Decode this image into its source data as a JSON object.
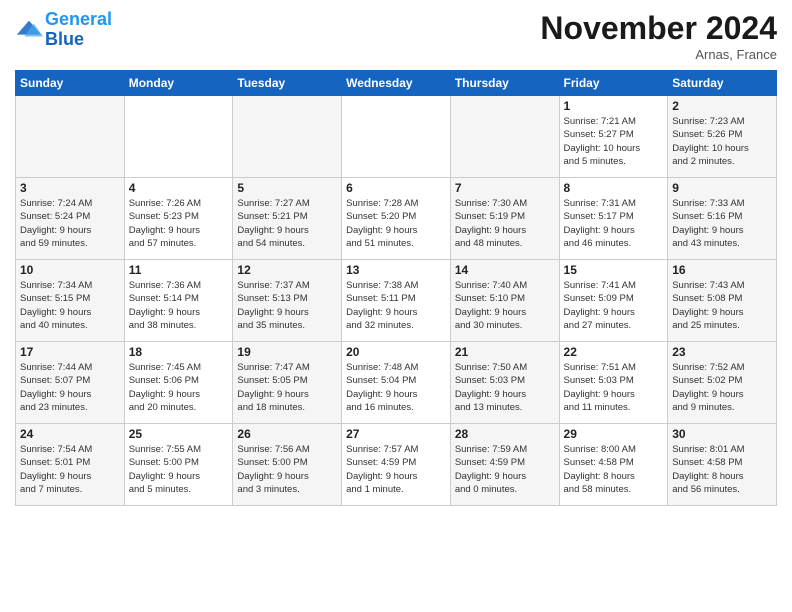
{
  "header": {
    "logo_line1": "General",
    "logo_line2": "Blue",
    "month": "November 2024",
    "location": "Arnas, France"
  },
  "weekdays": [
    "Sunday",
    "Monday",
    "Tuesday",
    "Wednesday",
    "Thursday",
    "Friday",
    "Saturday"
  ],
  "weeks": [
    [
      {
        "day": "",
        "info": ""
      },
      {
        "day": "",
        "info": ""
      },
      {
        "day": "",
        "info": ""
      },
      {
        "day": "",
        "info": ""
      },
      {
        "day": "",
        "info": ""
      },
      {
        "day": "1",
        "info": "Sunrise: 7:21 AM\nSunset: 5:27 PM\nDaylight: 10 hours\nand 5 minutes."
      },
      {
        "day": "2",
        "info": "Sunrise: 7:23 AM\nSunset: 5:26 PM\nDaylight: 10 hours\nand 2 minutes."
      }
    ],
    [
      {
        "day": "3",
        "info": "Sunrise: 7:24 AM\nSunset: 5:24 PM\nDaylight: 9 hours\nand 59 minutes."
      },
      {
        "day": "4",
        "info": "Sunrise: 7:26 AM\nSunset: 5:23 PM\nDaylight: 9 hours\nand 57 minutes."
      },
      {
        "day": "5",
        "info": "Sunrise: 7:27 AM\nSunset: 5:21 PM\nDaylight: 9 hours\nand 54 minutes."
      },
      {
        "day": "6",
        "info": "Sunrise: 7:28 AM\nSunset: 5:20 PM\nDaylight: 9 hours\nand 51 minutes."
      },
      {
        "day": "7",
        "info": "Sunrise: 7:30 AM\nSunset: 5:19 PM\nDaylight: 9 hours\nand 48 minutes."
      },
      {
        "day": "8",
        "info": "Sunrise: 7:31 AM\nSunset: 5:17 PM\nDaylight: 9 hours\nand 46 minutes."
      },
      {
        "day": "9",
        "info": "Sunrise: 7:33 AM\nSunset: 5:16 PM\nDaylight: 9 hours\nand 43 minutes."
      }
    ],
    [
      {
        "day": "10",
        "info": "Sunrise: 7:34 AM\nSunset: 5:15 PM\nDaylight: 9 hours\nand 40 minutes."
      },
      {
        "day": "11",
        "info": "Sunrise: 7:36 AM\nSunset: 5:14 PM\nDaylight: 9 hours\nand 38 minutes."
      },
      {
        "day": "12",
        "info": "Sunrise: 7:37 AM\nSunset: 5:13 PM\nDaylight: 9 hours\nand 35 minutes."
      },
      {
        "day": "13",
        "info": "Sunrise: 7:38 AM\nSunset: 5:11 PM\nDaylight: 9 hours\nand 32 minutes."
      },
      {
        "day": "14",
        "info": "Sunrise: 7:40 AM\nSunset: 5:10 PM\nDaylight: 9 hours\nand 30 minutes."
      },
      {
        "day": "15",
        "info": "Sunrise: 7:41 AM\nSunset: 5:09 PM\nDaylight: 9 hours\nand 27 minutes."
      },
      {
        "day": "16",
        "info": "Sunrise: 7:43 AM\nSunset: 5:08 PM\nDaylight: 9 hours\nand 25 minutes."
      }
    ],
    [
      {
        "day": "17",
        "info": "Sunrise: 7:44 AM\nSunset: 5:07 PM\nDaylight: 9 hours\nand 23 minutes."
      },
      {
        "day": "18",
        "info": "Sunrise: 7:45 AM\nSunset: 5:06 PM\nDaylight: 9 hours\nand 20 minutes."
      },
      {
        "day": "19",
        "info": "Sunrise: 7:47 AM\nSunset: 5:05 PM\nDaylight: 9 hours\nand 18 minutes."
      },
      {
        "day": "20",
        "info": "Sunrise: 7:48 AM\nSunset: 5:04 PM\nDaylight: 9 hours\nand 16 minutes."
      },
      {
        "day": "21",
        "info": "Sunrise: 7:50 AM\nSunset: 5:03 PM\nDaylight: 9 hours\nand 13 minutes."
      },
      {
        "day": "22",
        "info": "Sunrise: 7:51 AM\nSunset: 5:03 PM\nDaylight: 9 hours\nand 11 minutes."
      },
      {
        "day": "23",
        "info": "Sunrise: 7:52 AM\nSunset: 5:02 PM\nDaylight: 9 hours\nand 9 minutes."
      }
    ],
    [
      {
        "day": "24",
        "info": "Sunrise: 7:54 AM\nSunset: 5:01 PM\nDaylight: 9 hours\nand 7 minutes."
      },
      {
        "day": "25",
        "info": "Sunrise: 7:55 AM\nSunset: 5:00 PM\nDaylight: 9 hours\nand 5 minutes."
      },
      {
        "day": "26",
        "info": "Sunrise: 7:56 AM\nSunset: 5:00 PM\nDaylight: 9 hours\nand 3 minutes."
      },
      {
        "day": "27",
        "info": "Sunrise: 7:57 AM\nSunset: 4:59 PM\nDaylight: 9 hours\nand 1 minute."
      },
      {
        "day": "28",
        "info": "Sunrise: 7:59 AM\nSunset: 4:59 PM\nDaylight: 9 hours\nand 0 minutes."
      },
      {
        "day": "29",
        "info": "Sunrise: 8:00 AM\nSunset: 4:58 PM\nDaylight: 8 hours\nand 58 minutes."
      },
      {
        "day": "30",
        "info": "Sunrise: 8:01 AM\nSunset: 4:58 PM\nDaylight: 8 hours\nand 56 minutes."
      }
    ]
  ]
}
